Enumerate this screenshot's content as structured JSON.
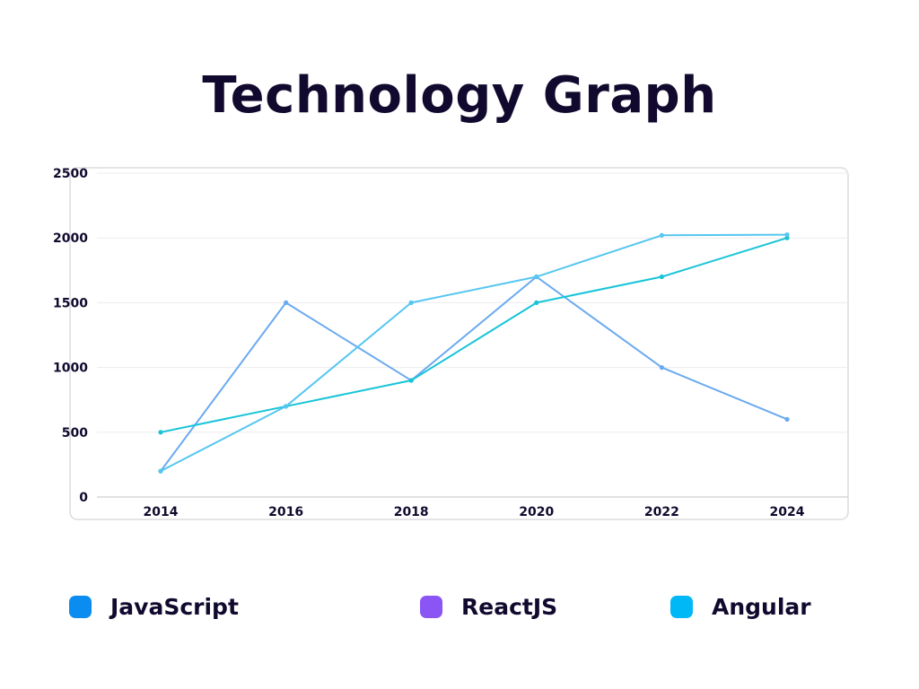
{
  "chart_data": {
    "type": "line",
    "title": "Technology Graph",
    "xlabel": "",
    "ylabel": "",
    "x": [
      "2014",
      "2016",
      "2018",
      "2020",
      "2022",
      "2024"
    ],
    "ylim": [
      0,
      2500
    ],
    "yticks": [
      "0",
      "500",
      "1000",
      "1500",
      "2000",
      "2500"
    ],
    "grid": true,
    "legend_position": "bottom",
    "series": [
      {
        "name": "JavaScript",
        "color": "#0a8cf0",
        "line_color": "#6aaaf0",
        "values": [
          200,
          1500,
          900,
          1700,
          1000,
          600
        ]
      },
      {
        "name": "ReactJS",
        "color": "#8b55f6",
        "line_color": "#16c4d8",
        "values": [
          500,
          700,
          900,
          1500,
          1700,
          2000
        ]
      },
      {
        "name": "Angular",
        "color": "#00b8f5",
        "line_color": "#56c6f0",
        "values": [
          200,
          700,
          1500,
          1700,
          2020,
          2025
        ]
      }
    ]
  }
}
